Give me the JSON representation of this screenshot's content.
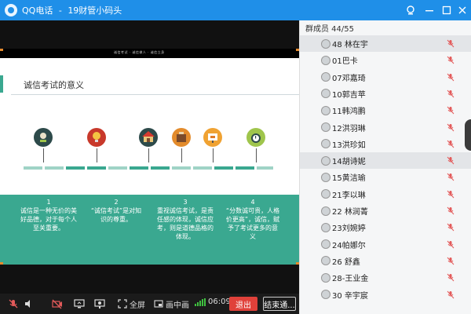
{
  "window": {
    "app_name": "QQ电话",
    "separator": "-",
    "chat_name": "19财管小码头"
  },
  "slide": {
    "header_text": "诚信考试 · 诚信做人 · 诚信立身",
    "title": "诚信考试的意义",
    "columns": [
      {
        "num": "1",
        "text": "诚信是一种无价的美好品德，对于每个人至关重要。"
      },
      {
        "num": "2",
        "text": "“诚信考试”是对知识的尊重。"
      },
      {
        "num": "3",
        "text": "重视诚信考试，是责任感的体现，诚信应考，则是道德品格的体现。"
      },
      {
        "num": "4",
        "text": "“分数诚可贵，人格价更高”，诚信，赋予了考试更多的意义"
      }
    ]
  },
  "controls": {
    "fullscreen_label": "全屏",
    "pip_label": "画中画",
    "timer": "06:09",
    "exit_label": "退出",
    "end_label": "结束通..."
  },
  "panel": {
    "members_label": "群成员 44/55",
    "members": [
      {
        "name": "48 林在宇",
        "active": true
      },
      {
        "name": "01巴卡",
        "active": false
      },
      {
        "name": "07邓嘉琦",
        "active": false
      },
      {
        "name": "10郭吉苹",
        "active": false
      },
      {
        "name": "11韩鸿鹏",
        "active": false
      },
      {
        "name": "12洪羽琳",
        "active": false
      },
      {
        "name": "13洪珍如",
        "active": false
      },
      {
        "name": "14胡诗妮",
        "active": true
      },
      {
        "name": "15黄洁瑜",
        "active": false
      },
      {
        "name": "21李以琳",
        "active": false
      },
      {
        "name": "22 林润菁",
        "active": false
      },
      {
        "name": "23刘婉婷",
        "active": false
      },
      {
        "name": "24帕娜尔",
        "active": false
      },
      {
        "name": "26  舒鑫",
        "active": false
      },
      {
        "name": "28-王业金",
        "active": false
      },
      {
        "name": "30 辛宇宸",
        "active": false
      }
    ]
  },
  "colors": {
    "titlebar": "#1f8fe8",
    "slide_green": "#3aa890",
    "exit_red": "#e0413a",
    "mic_muted": "#e35a5a"
  },
  "icons": [
    "webcam-icon",
    "minimize-icon",
    "maximize-icon",
    "close-icon",
    "mic-muted-icon",
    "speaker-icon",
    "camera-off-icon",
    "screen-share-icon",
    "presentation-icon",
    "fullscreen-icon",
    "pip-icon",
    "signal-icon"
  ]
}
